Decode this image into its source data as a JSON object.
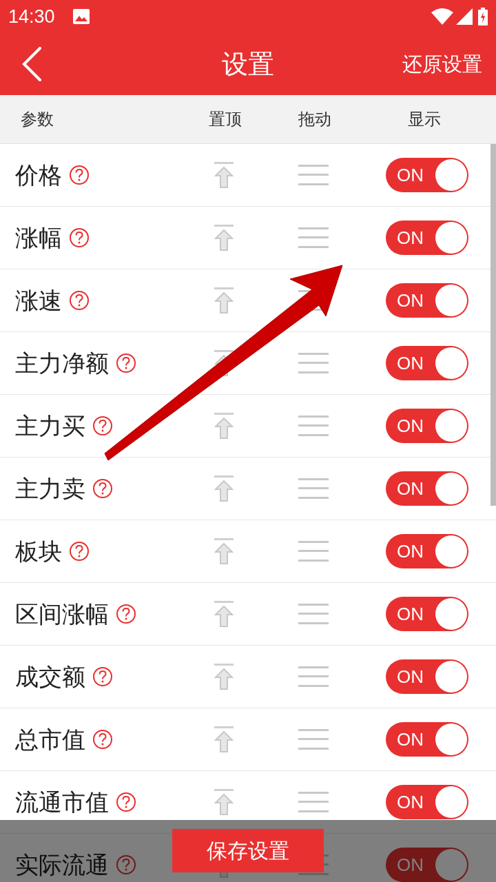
{
  "status_bar": {
    "time": "14:30"
  },
  "header": {
    "title": "设置",
    "action": "还原设置"
  },
  "columns": [
    "参数",
    "置顶",
    "拖动",
    "显示"
  ],
  "rows": [
    {
      "name": "价格",
      "toggle": {
        "on": true,
        "label": "ON"
      }
    },
    {
      "name": "涨幅",
      "toggle": {
        "on": true,
        "label": "ON"
      }
    },
    {
      "name": "涨速",
      "toggle": {
        "on": true,
        "label": "ON"
      }
    },
    {
      "name": "主力净额",
      "toggle": {
        "on": true,
        "label": "ON"
      }
    },
    {
      "name": "主力买",
      "toggle": {
        "on": true,
        "label": "ON"
      }
    },
    {
      "name": "主力卖",
      "toggle": {
        "on": true,
        "label": "ON"
      }
    },
    {
      "name": "板块",
      "toggle": {
        "on": true,
        "label": "ON"
      }
    },
    {
      "name": "区间涨幅",
      "toggle": {
        "on": true,
        "label": "ON"
      }
    },
    {
      "name": "成交额",
      "toggle": {
        "on": true,
        "label": "ON"
      }
    },
    {
      "name": "总市值",
      "toggle": {
        "on": true,
        "label": "ON"
      }
    },
    {
      "name": "流通市值",
      "toggle": {
        "on": true,
        "label": "ON"
      }
    },
    {
      "name": "实际流通",
      "toggle": {
        "on": true,
        "label": "ON"
      }
    }
  ],
  "save_button": "保存设置"
}
